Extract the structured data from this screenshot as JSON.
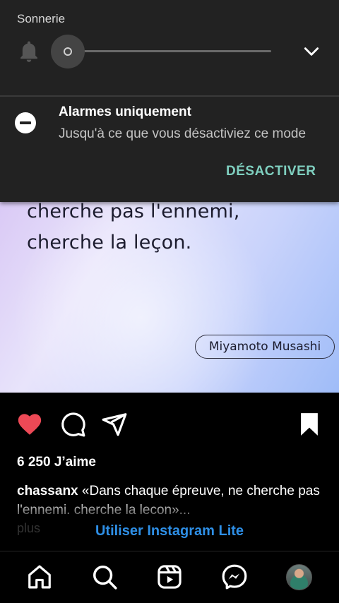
{
  "volume_panel": {
    "title": "Sonnerie",
    "level": 0,
    "icons": {
      "ringer": "bell-icon",
      "expand": "chevron-down-icon"
    }
  },
  "dnd": {
    "icon": "do-not-disturb-icon",
    "title": "Alarmes uniquement",
    "subtitle": "Jusqu'à ce que vous désactiviez ce mode",
    "action": "DÉSACTIVER",
    "action_color": "#7fcfbf"
  },
  "post": {
    "quote_line_1": "cherche pas l'ennemi,",
    "quote_line_2": "cherche la leçon.",
    "author": "Miyamoto Musashi",
    "liked": true,
    "like_color": "#ed4956",
    "likes": "6 250 J’aime",
    "caption_user": "chassanx",
    "caption_text": "«Dans chaque épreuve, ne cherche pas l'ennemi. cherche la lecon»...",
    "more": "plus",
    "banner": "Utiliser Instagram Lite"
  },
  "actions": [
    "heart-icon",
    "comment-icon",
    "share-icon",
    "bookmark-icon"
  ],
  "nav": [
    "home-icon",
    "search-icon",
    "reels-icon",
    "messenger-icon",
    "profile-avatar"
  ]
}
